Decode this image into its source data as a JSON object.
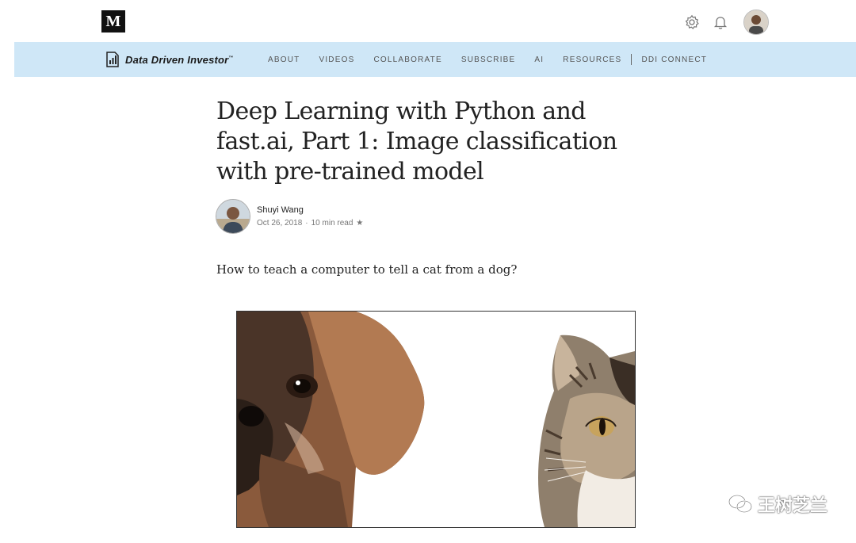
{
  "medium": {
    "logo_letter": "M",
    "icons": [
      "gear-icon",
      "bell-icon",
      "user-avatar"
    ]
  },
  "publication": {
    "name": "Data Driven Investor",
    "trademark": "™",
    "nav": [
      "ABOUT",
      "VIDEOS",
      "COLLABORATE",
      "SUBSCRIBE",
      "AI",
      "RESOURCES",
      "DDI CONNECT"
    ],
    "nav_bg": "#cfe7f7"
  },
  "article": {
    "title": "Deep Learning with Python and fast.ai, Part 1: Image classification with pre-trained model",
    "author": "Shuyi Wang",
    "date": "Oct 26, 2018",
    "read_time": "10 min read",
    "lead": "How to teach a computer to tell a cat from a dog?"
  },
  "watermark": {
    "text": "王树芝兰"
  }
}
